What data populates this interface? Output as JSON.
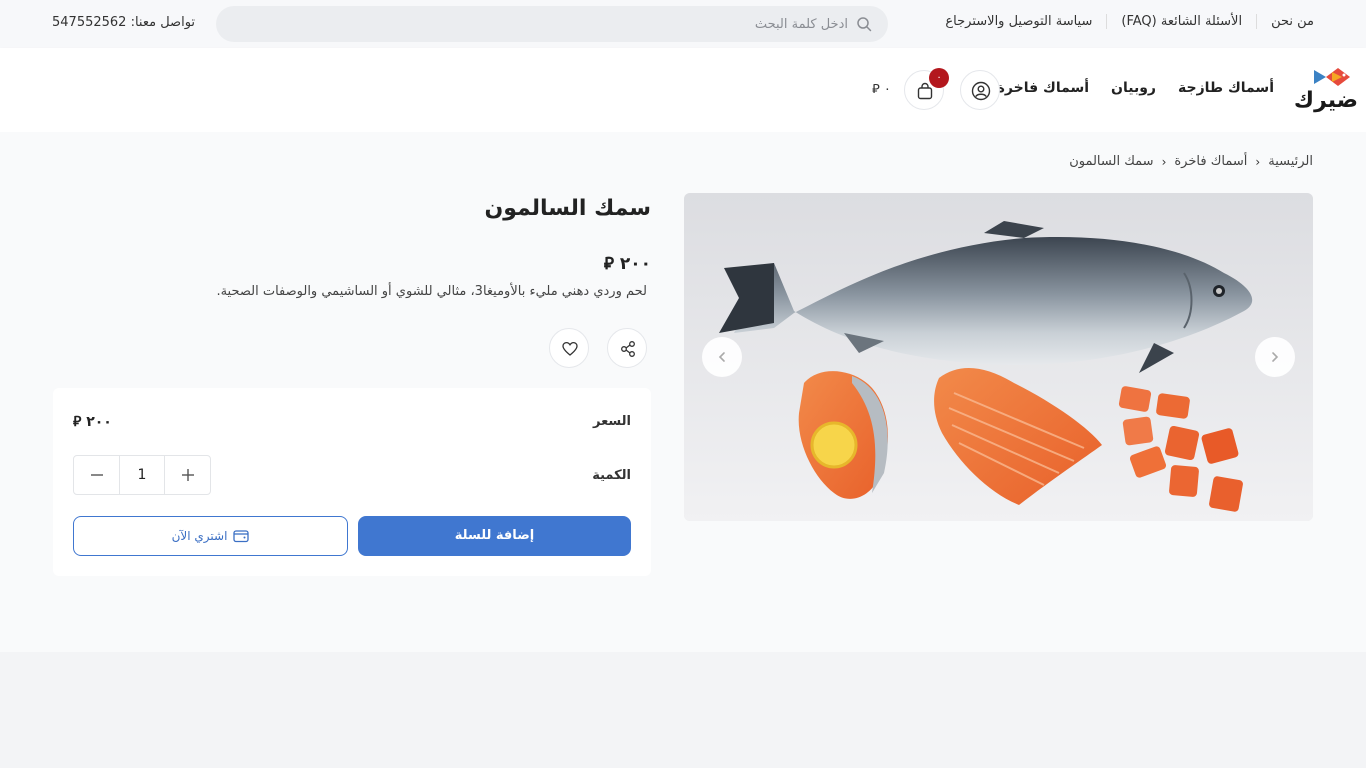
{
  "topbar": {
    "links": [
      "من نحن",
      "الأسئلة الشائعة (FAQ)",
      "سياسة التوصيل والاسترجاع"
    ],
    "search_placeholder": "ادخل كلمة البحث",
    "contact": "تواصل معنا: 547552562"
  },
  "header": {
    "logo_text": "ضيرك",
    "nav": [
      "أسماك طازجة",
      "روبيان",
      "أسماك فاخرة"
    ],
    "cart_count": "٠",
    "cart_total": "٠ ⃁"
  },
  "breadcrumb": [
    "الرئيسية",
    "أسماك فاخرة",
    "سمك السالمون"
  ],
  "product": {
    "title": "سمك السالمون",
    "price": "٢٠٠ ⃁",
    "description": "لحم وردي دهني مليء بالأوميغا3، مثالي للشوي أو الساشيمي والوصفات الصحية.",
    "price_label": "السعر",
    "box_price": "٢٠٠ ⃁",
    "quantity_label": "الكمية",
    "quantity": "1",
    "add_to_cart": "إضافة للسلة",
    "buy_now": "اشتري الآن"
  },
  "colors": {
    "primary": "#4077d0",
    "badge": "#b3171d"
  }
}
